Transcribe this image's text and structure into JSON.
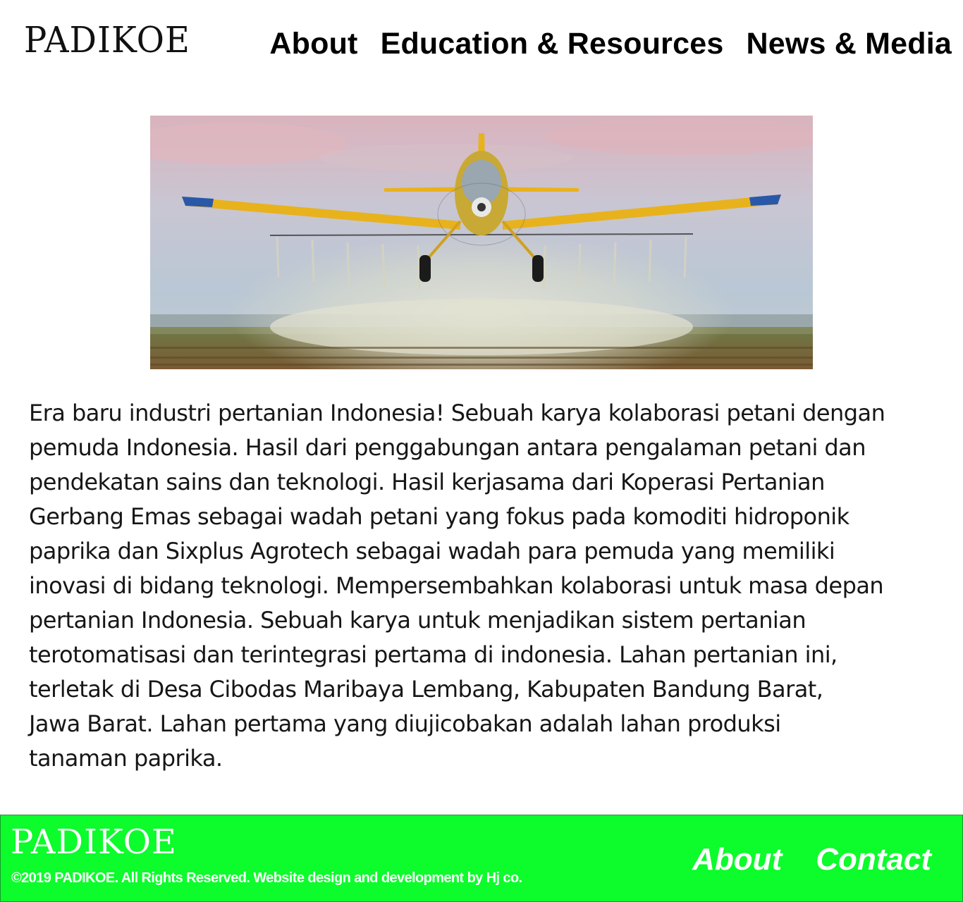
{
  "header": {
    "logo": "PADIKOE",
    "nav": [
      {
        "label": "About"
      },
      {
        "label": "Education & Resources"
      },
      {
        "label": "News & Media"
      }
    ]
  },
  "hero": {
    "image": "crop-duster-airplane-spraying-field"
  },
  "intro": {
    "lines": [
      "Era baru industri pertanian Indonesia! Sebuah karya kolaborasi petani dengan",
      "pemuda Indonesia. Hasil dari penggabungan antara pengalaman petani dan",
      "pendekatan sains dan teknologi. Hasil kerjasama dari Koperasi Pertanian",
      "Gerbang Emas sebagai wadah petani yang fokus pada komoditi hidroponik",
      "paprika dan Sixplus Agrotech sebagai wadah para pemuda yang memiliki",
      "inovasi di bidang teknologi. Mempersembahkan kolaborasi untuk masa depan",
      "pertanian Indonesia. Sebuah karya untuk menjadikan sistem pertanian",
      "terotomatisasi dan terintegrasi pertama di indonesia. Lahan pertanian ini,",
      "terletak di Desa Cibodas Maribaya Lembang, Kabupaten Bandung Barat,",
      "Jawa Barat. Lahan pertama yang diujicobakan adalah lahan produksi",
      "tanaman paprika."
    ]
  },
  "footer": {
    "logo": "PADIKOE",
    "copyright": "©2019 PADIKOE. All Rights Reserved. Website design and development by Hj co.",
    "nav": [
      {
        "label": "About"
      },
      {
        "label": "Contact"
      }
    ],
    "background": "#0cfc2c"
  }
}
